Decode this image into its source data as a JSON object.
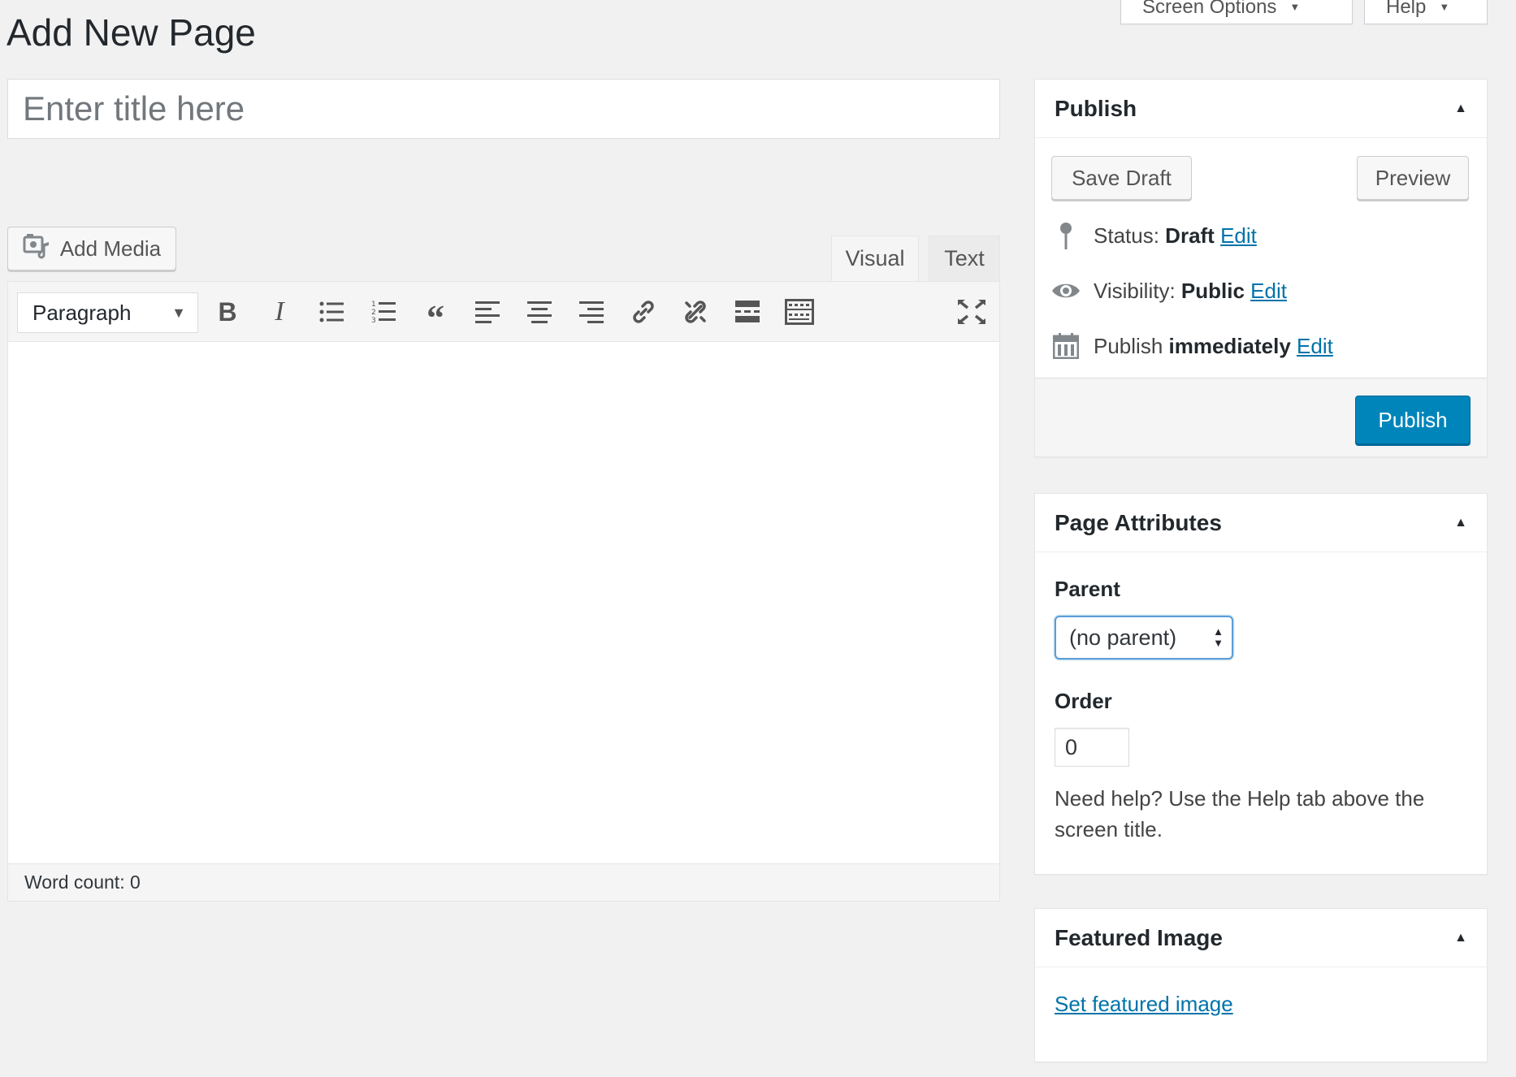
{
  "header": {
    "page_title": "Add New Page",
    "screen_options_label": "Screen Options",
    "help_label": "Help"
  },
  "title_field": {
    "placeholder": "Enter title here",
    "value": ""
  },
  "editor": {
    "add_media_label": "Add Media",
    "tabs": [
      {
        "label": "Visual",
        "active": true
      },
      {
        "label": "Text",
        "active": false
      }
    ],
    "format_select": {
      "value": "Paragraph"
    },
    "toolbar_icons": [
      "bold-icon",
      "italic-icon",
      "bulleted-list-icon",
      "numbered-list-icon",
      "blockquote-icon",
      "align-left-icon",
      "align-center-icon",
      "align-right-icon",
      "insert-link-icon",
      "remove-link-icon",
      "read-more-icon",
      "toolbar-toggle-icon",
      "fullscreen-icon"
    ],
    "word_count": "Word count: 0"
  },
  "publish_box": {
    "title": "Publish",
    "save_draft_label": "Save Draft",
    "preview_label": "Preview",
    "status_label": "Status:",
    "status_value": "Draft",
    "visibility_label": "Visibility:",
    "visibility_value": "Public",
    "publish_label": "Publish",
    "publish_value": "immediately",
    "edit_label": "Edit",
    "publish_button_label": "Publish",
    "accent_color": "#0085ba"
  },
  "page_attributes": {
    "title": "Page Attributes",
    "parent_label": "Parent",
    "parent_value": "(no parent)",
    "order_label": "Order",
    "order_value": "0",
    "help_text": "Need help? Use the Help tab above the screen title."
  },
  "featured_image": {
    "title": "Featured Image",
    "set_link": "Set featured image"
  }
}
